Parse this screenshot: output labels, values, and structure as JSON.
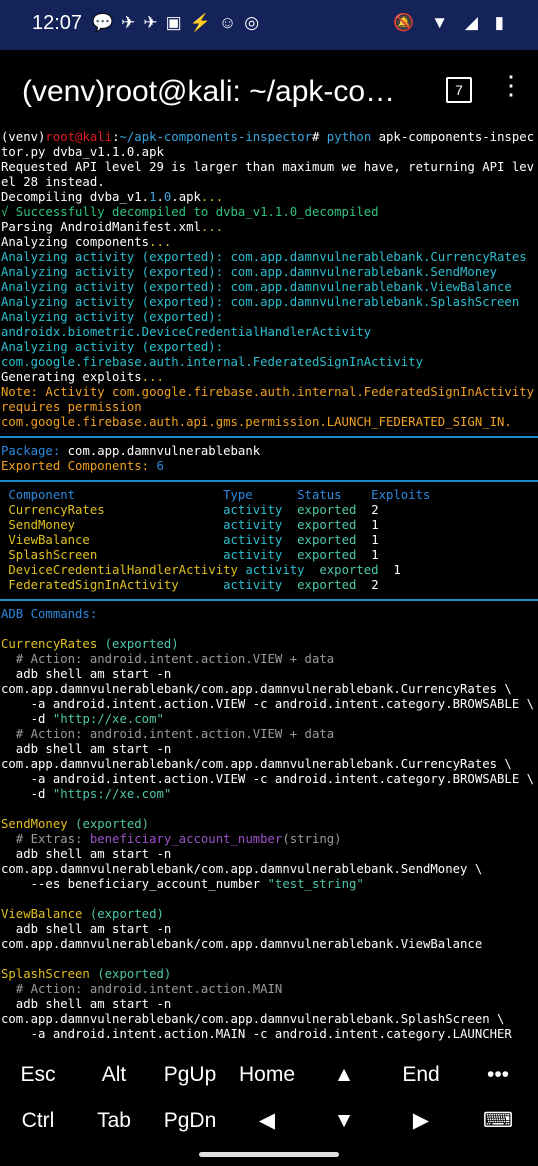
{
  "status": {
    "time": "12:07",
    "notif_icons": "💬✈✈▣⚡☺◎",
    "right_icons": "🔕 ▼ ◢ ▮"
  },
  "appbar": {
    "title": "(venv)root@kali: ~/apk-co…",
    "tab_count": "7",
    "menu_glyph": "⋮"
  },
  "terminal": {
    "lines": [
      {
        "t": "p",
        "segs": [
          [
            "w",
            "(venv)"
          ],
          [
            "r",
            "root"
          ],
          [
            "r",
            "@"
          ],
          [
            "r",
            "kali"
          ],
          [
            "w",
            ":"
          ],
          [
            "b",
            "~/apk-components-inspector"
          ],
          [
            "w",
            "# "
          ],
          [
            "b",
            "python "
          ],
          [
            "w",
            "apk-components-inspec"
          ]
        ]
      },
      {
        "t": "p",
        "segs": [
          [
            "w",
            "tor.py dvba_v1.1.0.apk"
          ]
        ]
      },
      {
        "t": "p",
        "segs": [
          [
            "w",
            "Requested API level 29 is larger than maximum we have, returning API lev"
          ]
        ]
      },
      {
        "t": "p",
        "segs": [
          [
            "w",
            "el 28 instead."
          ]
        ]
      },
      {
        "t": "p",
        "segs": [
          [
            "w",
            "Decompiling dvba_v1."
          ],
          [
            "b",
            "1"
          ],
          [
            "w",
            "."
          ],
          [
            "b",
            "0"
          ],
          [
            "w",
            ".apk"
          ],
          [
            "y",
            "..."
          ]
        ]
      },
      {
        "t": "p",
        "segs": [
          [
            "g",
            "√ Successfully decompiled to dvba_v1.1.0_decompiled"
          ]
        ]
      },
      {
        "t": "p",
        "segs": [
          [
            "w",
            "Parsing AndroidManifest.xml"
          ],
          [
            "y",
            "..."
          ]
        ]
      },
      {
        "t": "p",
        "segs": [
          [
            "w",
            "Analyzing components"
          ],
          [
            "y",
            "..."
          ]
        ]
      },
      {
        "t": "p",
        "segs": [
          [
            "c",
            "Analyzing activity (exported): com.app.damnvulnerablebank.CurrencyRates"
          ]
        ]
      },
      {
        "t": "p",
        "segs": [
          [
            "c",
            "Analyzing activity (exported): com.app.damnvulnerablebank.SendMoney"
          ]
        ]
      },
      {
        "t": "p",
        "segs": [
          [
            "c",
            "Analyzing activity (exported): com.app.damnvulnerablebank.ViewBalance"
          ]
        ]
      },
      {
        "t": "p",
        "segs": [
          [
            "c",
            "Analyzing activity (exported): com.app.damnvulnerablebank.SplashScreen"
          ]
        ]
      },
      {
        "t": "p",
        "segs": [
          [
            "c",
            "Analyzing activity (exported):"
          ]
        ]
      },
      {
        "t": "p",
        "segs": [
          [
            "c",
            "androidx.biometric.DeviceCredentialHandlerActivity"
          ]
        ]
      },
      {
        "t": "p",
        "segs": [
          [
            "c",
            "Analyzing activity (exported):"
          ]
        ]
      },
      {
        "t": "p",
        "segs": [
          [
            "c",
            "com.google.firebase.auth.internal.FederatedSignInActivity"
          ]
        ]
      },
      {
        "t": "p",
        "segs": [
          [
            "w",
            "Generating exploits"
          ],
          [
            "y",
            "..."
          ]
        ]
      },
      {
        "t": "p",
        "segs": [
          [
            "o",
            "Note: Activity com.google.firebase.auth.internal.FederatedSignInActivity"
          ]
        ]
      },
      {
        "t": "p",
        "segs": [
          [
            "o",
            "requires permission"
          ]
        ]
      },
      {
        "t": "p",
        "segs": [
          [
            "o",
            "com.google.firebase.auth.api.gms.permission.LAUNCH_FEDERATED_SIGN_IN."
          ]
        ]
      },
      {
        "t": "sep"
      },
      {
        "t": "p",
        "segs": [
          [
            "bl",
            "Package: "
          ],
          [
            "w",
            "com.app.damnvulnerablebank"
          ]
        ]
      },
      {
        "t": "p",
        "segs": [
          [
            "o",
            "Exported Components: "
          ],
          [
            "bl",
            "6"
          ]
        ]
      },
      {
        "t": "sep"
      },
      {
        "t": "p",
        "segs": [
          [
            "bl",
            " Component                    Type      Status    Exploits"
          ]
        ]
      },
      {
        "t": "p",
        "segs": [
          [
            "y",
            " CurrencyRates                "
          ],
          [
            "c",
            "activity  "
          ],
          [
            "tl",
            "exported  "
          ],
          [
            "w",
            "2"
          ]
        ]
      },
      {
        "t": "p",
        "segs": [
          [
            "y",
            " SendMoney                    "
          ],
          [
            "c",
            "activity  "
          ],
          [
            "tl",
            "exported  "
          ],
          [
            "w",
            "1"
          ]
        ]
      },
      {
        "t": "p",
        "segs": [
          [
            "y",
            " ViewBalance                  "
          ],
          [
            "c",
            "activity  "
          ],
          [
            "tl",
            "exported  "
          ],
          [
            "w",
            "1"
          ]
        ]
      },
      {
        "t": "p",
        "segs": [
          [
            "y",
            " SplashScreen                 "
          ],
          [
            "c",
            "activity  "
          ],
          [
            "tl",
            "exported  "
          ],
          [
            "w",
            "1"
          ]
        ]
      },
      {
        "t": "p",
        "segs": [
          [
            "y",
            " DeviceCredentialHandlerActivity "
          ],
          [
            "c",
            "activity  "
          ],
          [
            "tl",
            "exported  "
          ],
          [
            "w",
            "1"
          ]
        ]
      },
      {
        "t": "p",
        "segs": [
          [
            "y",
            " FederatedSignInActivity      "
          ],
          [
            "c",
            "activity  "
          ],
          [
            "tl",
            "exported  "
          ],
          [
            "w",
            "2"
          ]
        ]
      },
      {
        "t": "sep"
      },
      {
        "t": "p",
        "segs": [
          [
            "bl",
            "ADB Commands:"
          ]
        ]
      },
      {
        "t": "p",
        "segs": [
          [
            "w",
            ""
          ]
        ]
      },
      {
        "t": "p",
        "segs": [
          [
            "y",
            "CurrencyRates "
          ],
          [
            "tl",
            "(exported)"
          ]
        ]
      },
      {
        "t": "p",
        "segs": [
          [
            "gy",
            "  # Action: android.intent.action.VIEW + data"
          ]
        ]
      },
      {
        "t": "p",
        "segs": [
          [
            "w",
            "  adb shell am start -n"
          ]
        ]
      },
      {
        "t": "p",
        "segs": [
          [
            "w",
            "com.app.damnvulnerablebank/com.app.damnvulnerablebank.CurrencyRates \\"
          ]
        ]
      },
      {
        "t": "p",
        "segs": [
          [
            "w",
            "    -a android.intent.action.VIEW -c android.intent.category.BROWSABLE \\"
          ]
        ]
      },
      {
        "t": "p",
        "segs": [
          [
            "w",
            "    -d "
          ],
          [
            "tl",
            "\"http://xe.com\""
          ]
        ]
      },
      {
        "t": "p",
        "segs": [
          [
            "gy",
            "  # Action: android.intent.action.VIEW + data"
          ]
        ]
      },
      {
        "t": "p",
        "segs": [
          [
            "w",
            "  adb shell am start -n"
          ]
        ]
      },
      {
        "t": "p",
        "segs": [
          [
            "w",
            "com.app.damnvulnerablebank/com.app.damnvulnerablebank.CurrencyRates \\"
          ]
        ]
      },
      {
        "t": "p",
        "segs": [
          [
            "w",
            "    -a android.intent.action.VIEW -c android.intent.category.BROWSABLE \\"
          ]
        ]
      },
      {
        "t": "p",
        "segs": [
          [
            "w",
            "    -d "
          ],
          [
            "tl",
            "\"https://xe.com\""
          ]
        ]
      },
      {
        "t": "p",
        "segs": [
          [
            "w",
            ""
          ]
        ]
      },
      {
        "t": "p",
        "segs": [
          [
            "y",
            "SendMoney "
          ],
          [
            "tl",
            "(exported)"
          ]
        ]
      },
      {
        "t": "p",
        "segs": [
          [
            "gy",
            "  # Extras: "
          ],
          [
            "p",
            "beneficiary_account_number"
          ],
          [
            "gy",
            "(string)"
          ]
        ]
      },
      {
        "t": "p",
        "segs": [
          [
            "w",
            "  adb shell am start -n"
          ]
        ]
      },
      {
        "t": "p",
        "segs": [
          [
            "w",
            "com.app.damnvulnerablebank/com.app.damnvulnerablebank.SendMoney \\"
          ]
        ]
      },
      {
        "t": "p",
        "segs": [
          [
            "w",
            "    --es beneficiary_account_number "
          ],
          [
            "tl",
            "\"test_string\""
          ]
        ]
      },
      {
        "t": "p",
        "segs": [
          [
            "w",
            ""
          ]
        ]
      },
      {
        "t": "p",
        "segs": [
          [
            "y",
            "ViewBalance "
          ],
          [
            "tl",
            "(exported)"
          ]
        ]
      },
      {
        "t": "p",
        "segs": [
          [
            "w",
            "  adb shell am start -n"
          ]
        ]
      },
      {
        "t": "p",
        "segs": [
          [
            "w",
            "com.app.damnvulnerablebank/com.app.damnvulnerablebank.ViewBalance"
          ]
        ]
      },
      {
        "t": "p",
        "segs": [
          [
            "w",
            ""
          ]
        ]
      },
      {
        "t": "p",
        "segs": [
          [
            "y",
            "SplashScreen "
          ],
          [
            "tl",
            "(exported)"
          ]
        ]
      },
      {
        "t": "p",
        "segs": [
          [
            "gy",
            "  # Action: android.intent.action.MAIN"
          ]
        ]
      },
      {
        "t": "p",
        "segs": [
          [
            "w",
            "  adb shell am start -n"
          ]
        ]
      },
      {
        "t": "p",
        "segs": [
          [
            "w",
            "com.app.damnvulnerablebank/com.app.damnvulnerablebank.SplashScreen \\"
          ]
        ]
      },
      {
        "t": "p",
        "segs": [
          [
            "w",
            "    -a android.intent.action.MAIN -c android.intent.category.LAUNCHER"
          ]
        ]
      }
    ]
  },
  "keyboard": {
    "row1": [
      "Esc",
      "Alt",
      "PgUp",
      "Home",
      "▲",
      "End",
      "•••"
    ],
    "row2": [
      "Ctrl",
      "Tab",
      "PgDn",
      "◀",
      "▼",
      "▶",
      "⌨"
    ]
  }
}
